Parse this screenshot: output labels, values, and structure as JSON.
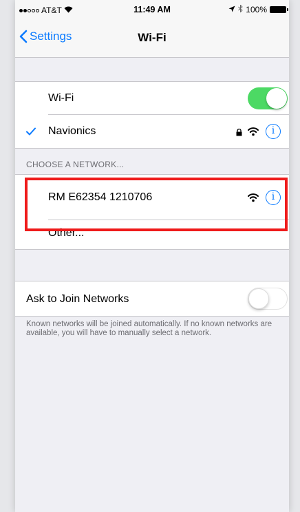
{
  "status_bar": {
    "carrier": "AT&T",
    "time": "11:49 AM",
    "battery": "100%",
    "icons": [
      "signal-dots",
      "wifi-icon",
      "location-arrow-icon",
      "bluetooth-icon",
      "battery-icon"
    ]
  },
  "nav": {
    "back_label": "Settings",
    "title": "Wi-Fi"
  },
  "wifi_toggle": {
    "label": "Wi-Fi",
    "state": "on"
  },
  "connected_network": {
    "name": "Navionics",
    "locked": true
  },
  "choose_header": "CHOOSE A NETWORK...",
  "networks": [
    {
      "name": "RM E62354 1210706",
      "locked": false
    }
  ],
  "other_label": "Other...",
  "ask_to_join": {
    "label": "Ask to Join Networks",
    "state": "off"
  },
  "footer_note": "Known networks will be joined automatically. If no known networks are available, you will have to manually select a network.",
  "colors": {
    "accent": "#0a7aff",
    "toggle_on": "#4cd964",
    "highlight": "#ef1b1b"
  }
}
